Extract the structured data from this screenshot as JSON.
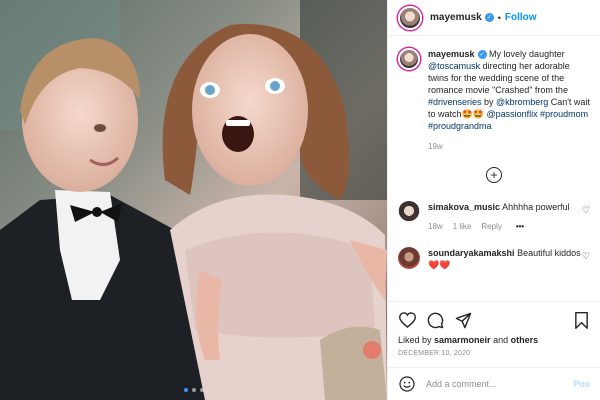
{
  "header": {
    "username": "mayemusk",
    "separator": "•",
    "follow_label": "Follow"
  },
  "caption": {
    "username": "mayemusk",
    "segments": [
      {
        "text": " My lovely daughter ",
        "link": false
      },
      {
        "text": "@toscamusk",
        "link": true
      },
      {
        "text": " directing her adorable twins for the wedding scene of the romance movie \"Crashed\" from the ",
        "link": false
      },
      {
        "text": "#drivenseries",
        "link": true
      },
      {
        "text": " by ",
        "link": false
      },
      {
        "text": "@kbromberg",
        "link": true
      },
      {
        "text": " Can't wait to watch🤩🤩 ",
        "link": false
      },
      {
        "text": "@passionflix",
        "link": true
      },
      {
        "text": " ",
        "link": false
      },
      {
        "text": "#proudmom",
        "link": true
      },
      {
        "text": " ",
        "link": false
      },
      {
        "text": "#proudgrandma",
        "link": true
      }
    ],
    "time": "19w"
  },
  "comments": [
    {
      "username": "simakova_music",
      "text": "Ahhhha powerful",
      "time": "18w",
      "likes": "1 like",
      "reply": "Reply"
    },
    {
      "username": "soundaryakamakshi",
      "text": "Beautiful kiddos❤️❤️",
      "time": "",
      "likes": "",
      "reply": ""
    }
  ],
  "actions": {
    "liked_by_prefix": "Liked by ",
    "liked_by_user": "samarmoneir",
    "liked_by_mid": " and ",
    "liked_by_others": "others",
    "date": "DECEMBER 10, 2020"
  },
  "composer": {
    "placeholder": "Add a comment...",
    "post_label": "Pos"
  },
  "carousel": {
    "count": 3,
    "active_index": 0
  },
  "colors": {
    "follow": "#0095f6",
    "verified": "#3897f0",
    "link": "#00376b",
    "muted": "#8e8e8e",
    "post_disabled": "#b2dffc"
  },
  "icons": [
    "verified-icon",
    "load-more-icon",
    "heart-icon",
    "comment-icon",
    "share-icon",
    "bookmark-icon",
    "emoji-icon",
    "more-options-icon"
  ]
}
